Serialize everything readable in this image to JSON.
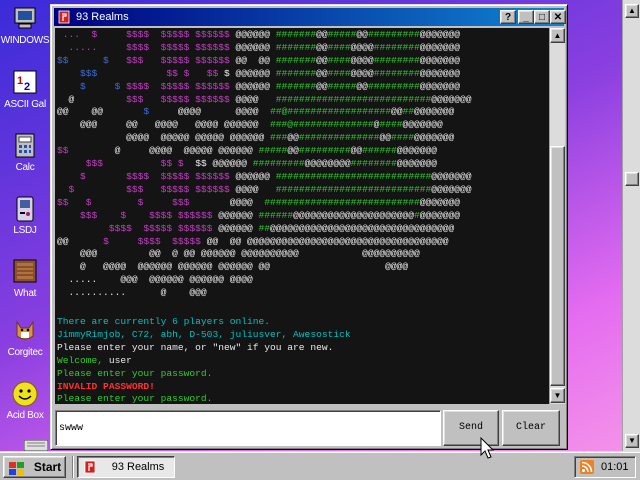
{
  "desktop": {
    "icons": [
      {
        "label": "WINDOWS"
      },
      {
        "label": "ASCII Gal"
      },
      {
        "label": "Calc"
      },
      {
        "label": "LSDJ"
      },
      {
        "label": "What"
      },
      {
        "label": "Corgitec"
      },
      {
        "label": "Acid Box"
      }
    ]
  },
  "window": {
    "title": "93 Realms",
    "minimize_label": "_",
    "maximize_label": "□",
    "close_label": "✕"
  },
  "terminal": {
    "art_lines": [
      [
        [
          "p",
          " ...  $     "
        ],
        [
          "p",
          "$$$$  $$$$$ $$$$$$ "
        ],
        [
          "w",
          "@@@@@@ "
        ],
        [
          "g",
          "#######"
        ],
        [
          "w",
          "@@"
        ],
        [
          "g",
          "#####"
        ],
        [
          "w",
          "@@"
        ],
        [
          "g",
          "#########"
        ],
        [
          "w",
          "@@@@@@@"
        ]
      ],
      [
        [
          "p",
          "  .....     "
        ],
        [
          "p",
          "$$$$  $$$$$ $$$$$$ "
        ],
        [
          "w",
          "@@@@@@ "
        ],
        [
          "g",
          "#######"
        ],
        [
          "w",
          "@@"
        ],
        [
          "g",
          "####"
        ],
        [
          "w",
          "@@@@"
        ],
        [
          "g",
          "########"
        ],
        [
          "w",
          "@@@@@@@"
        ]
      ],
      [
        [
          "b",
          "$$      $   "
        ],
        [
          "p",
          "$$$   $$$$$ $$$$$$ "
        ],
        [
          "w",
          "@@  @@ "
        ],
        [
          "g",
          "#######"
        ],
        [
          "w",
          "@@"
        ],
        [
          "g",
          "####"
        ],
        [
          "w",
          "@@@@"
        ],
        [
          "g",
          "########"
        ],
        [
          "w",
          "@@@@@@@"
        ]
      ],
      [
        [
          "b",
          "    $$$     "
        ],
        [
          "p",
          "       $$ $   $$ "
        ],
        [
          "w",
          "$ @@@@@@ "
        ],
        [
          "g",
          "#######"
        ],
        [
          "w",
          "@@"
        ],
        [
          "g",
          "####"
        ],
        [
          "w",
          "@@@@"
        ],
        [
          "g",
          "########"
        ],
        [
          "w",
          "@@@@@@@"
        ]
      ],
      [
        [
          "b",
          "    $     $ "
        ],
        [
          "p",
          "$$$$  $$$$$ $$$$$$ "
        ],
        [
          "w",
          "@@@@@@ "
        ],
        [
          "g",
          "#######"
        ],
        [
          "w",
          "@@"
        ],
        [
          "g",
          "#####"
        ],
        [
          "w",
          "@@"
        ],
        [
          "g",
          "#########"
        ],
        [
          "w",
          "@@@@@@@"
        ]
      ],
      [
        [
          "w",
          "  @         "
        ],
        [
          "p",
          "$$$   $$$$$ $$$$$$ "
        ],
        [
          "w",
          "@@@@   "
        ],
        [
          "g",
          "###########################"
        ],
        [
          "w",
          "@@@@@@@"
        ]
      ],
      [
        [
          "w",
          "@@    @@    "
        ],
        [
          "b",
          "   $   "
        ],
        [
          "w",
          "  @@@@ "
        ],
        [
          "w",
          "     @@@@  "
        ],
        [
          "g",
          "##@##################"
        ],
        [
          "w",
          "@@"
        ],
        [
          "g",
          "##"
        ],
        [
          "w",
          "@@@@@@@"
        ]
      ],
      [
        [
          "w",
          "    @@@     @@   @@@@   @@@@ @@@@@@  "
        ],
        [
          "g",
          "###@##############"
        ],
        [
          "w",
          "@"
        ],
        [
          "g",
          "####"
        ],
        [
          "w",
          "@@@@@@@"
        ]
      ],
      [
        [
          "w",
          "            @@@@  @@@@@ @@@@@ @@@@@@ "
        ],
        [
          "g",
          "###"
        ],
        [
          "w",
          "@@"
        ],
        [
          "g",
          "##############"
        ],
        [
          "w",
          "@@"
        ],
        [
          "g",
          "####"
        ],
        [
          "w",
          "@@@@@@@"
        ]
      ],
      [
        [
          "p",
          "$$     "
        ],
        [
          "w",
          "   @     @@@@  @@@@@ @@@@@@ "
        ],
        [
          "g",
          "#####"
        ],
        [
          "w",
          "@@"
        ],
        [
          "g",
          "#########"
        ],
        [
          "w",
          "@@"
        ],
        [
          "g",
          "######"
        ],
        [
          "w",
          "@@@@@@@"
        ]
      ],
      [
        [
          "p",
          "     $$$    "
        ],
        [
          "p",
          "      $$ $  "
        ],
        [
          "w",
          "$$ @@@@@@ "
        ],
        [
          "g",
          "#########"
        ],
        [
          "w",
          "@@@@@@@@"
        ],
        [
          "g",
          "########"
        ],
        [
          "w",
          "@@@@@@@"
        ]
      ],
      [
        [
          "p",
          "    $       $$$$  $$$$$ $$$$$$ "
        ],
        [
          "w",
          "@@@@@@ "
        ],
        [
          "g",
          "###########################"
        ],
        [
          "w",
          "@@@@@@@"
        ]
      ],
      [
        [
          "p",
          "  $     "
        ],
        [
          "p",
          "    $$$   $$$$$ $$$$$$ "
        ],
        [
          "w",
          "@@@@   "
        ],
        [
          "g",
          "###########################"
        ],
        [
          "w",
          "@@@@@@@"
        ]
      ],
      [
        [
          "p",
          "$$   $     "
        ],
        [
          "p",
          "   $     $$$    "
        ],
        [
          "w",
          "   @@@@  "
        ],
        [
          "g",
          "###########################"
        ],
        [
          "w",
          "@@@@@@@"
        ]
      ],
      [
        [
          "p",
          "    $$$    "
        ],
        [
          "p",
          "$    $$$$ $$$$$$ "
        ],
        [
          "w",
          "@@@@@@ "
        ],
        [
          "g",
          "######"
        ],
        [
          "w",
          "@@@@@@@@@@@@@@@@@@@@@"
        ],
        [
          "g",
          "#"
        ],
        [
          "w",
          "@@@@@@@"
        ]
      ],
      [
        [
          "p",
          "         $$$$  $$$$$ $$$$$$ "
        ],
        [
          "w",
          "@@@@@@ "
        ],
        [
          "g",
          "##"
        ],
        [
          "w",
          "@@@@@@@@@@@@@@@@@@@@@@@@@@@@@@@@"
        ]
      ],
      [
        [
          "w",
          "@@      "
        ],
        [
          "p",
          "$     $$$$  $$$$$ "
        ],
        [
          "w",
          "@@  @@ "
        ],
        [
          "w",
          "@@@@@@@@@@@@@@@@@@@@@@@@@@@@@@@@@@@"
        ]
      ],
      [
        [
          "w",
          "    @@@         @@  @ @@ @@@@@@ @@@@@@@@@@           @@@@@@@@@@"
        ]
      ],
      [
        [
          "w",
          "    @   @@@@  @@@@@@ @@@@@@ @@@@@@ @@                    @@@@"
        ]
      ],
      [
        [
          "w",
          "  .....    @@@  @@@@@@ @@@@@@ @@@@  "
        ]
      ],
      [
        [
          "w",
          "  ..........      @    @@@ "
        ]
      ]
    ],
    "messages": [
      {
        "cls": "c",
        "text": "There are currently 6 players online."
      },
      {
        "cls": "c",
        "text": "JimmyRimjob, C72, abh, D-503, juliusver, Awesostick"
      },
      {
        "cls": "y",
        "text": "Please enter your name, or \"new\" if you are new."
      },
      {
        "cls": "g",
        "text": "Welcome, ",
        "extra": "user"
      },
      {
        "cls": "g",
        "text": "Please enter your password."
      },
      {
        "cls": "r",
        "text": "INVALID PASSWORD!"
      },
      {
        "cls": "g",
        "text": "Please enter your password."
      }
    ]
  },
  "input": {
    "value": "swww",
    "send_label": "Send",
    "clear_label": "Clear"
  },
  "taskbar": {
    "start_label": "Start",
    "task_label": "93 Realms",
    "clock": "01:01"
  }
}
